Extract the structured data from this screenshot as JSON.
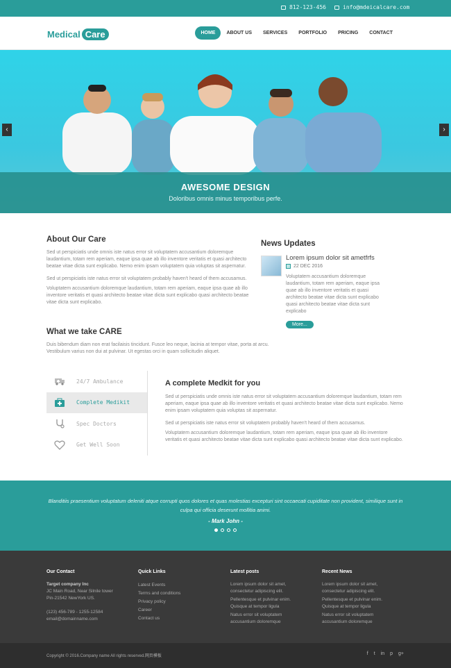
{
  "topbar": {
    "phone": "812-123-456",
    "email": "info@mdeicalcare.com"
  },
  "header": {
    "logo_text": "Medical",
    "logo_pill": "Care",
    "nav": [
      "HOME",
      "ABOUT US",
      "SERVICES",
      "PORTFOLIO",
      "PRICING",
      "CONTACT"
    ]
  },
  "hero": {
    "title": "AWESOME DESIGN",
    "subtitle": "Doloribus omnis minus temporibus perfe.",
    "prev": "‹",
    "next": "›"
  },
  "about": {
    "title": "About Our Care",
    "p1": "Sed ut perspiciatis unde omnis iste natus error sit voluptatem accusantium doloremque laudantium, totam rem aperiam, eaque ipsa quae ab illo inventore veritatis et quasi architecto beatae vitae dicta sunt explicabo. Nemo enim ipsam voluptatem quia voluptas sit aspernatur.",
    "p2": "Sed ut perspiciatis iste natus error sit voluptatem probably haven't heard of them accusamus.",
    "p3": "Voluptatem accusantium doloremque laudantium, totam rem aperiam, eaque ipsa quae ab illo inventore veritatis et quasi architecto beatae vitae dicta sunt explicabo quasi architecto beatae vitae dicta sunt explicabo."
  },
  "news": {
    "title": "News Updates",
    "item_title": "Lorem ipsum dolor sit ametfrfs",
    "date": "22 DEC 2016",
    "text": "Voluptatem accusantium doloremque laudantium, totam rem aperiam, eaque ipsa quae ab illo inventore veritatis et quasi architecto beatae vitae dicta sunt explicabo quasi architecto beatae vitae dicta sunt explicabo",
    "more": "More..."
  },
  "care": {
    "title": "What we take CARE",
    "text": "Duis bibendum diam non erat facilaisis tincidunt. Fusce leo neque, lacinia at tempor vitae, porta at arcu. Vestibulum varius non dui at pulvinar. Ut egestas orci in quam sollicitudin aliquet."
  },
  "tabs": [
    {
      "label": "24/7 Ambulance",
      "icon": "ambulance-icon"
    },
    {
      "label": "Complete Medikit",
      "icon": "medkit-icon"
    },
    {
      "label": "Spec Doctors",
      "icon": "stethoscope-icon"
    },
    {
      "label": "Get Well Soon",
      "icon": "heart-icon"
    }
  ],
  "medkit": {
    "title": "A complete Medkit for you",
    "p1": "Sed ut perspiciatis unde omnis iste natus error sit voluptatem accusantium doloremque laudantium, totam rem aperiam, eaque ipsa quae ab illo inventore veritatis et quasi architecto beatae vitae dicta sunt explicabo. Nemo enim ipsam voluptatem quia voluptas sit aspernatur.",
    "p2": "Sed ut perspiciatis iste natus error sit voluptatem probably haven't heard of them accusamus.",
    "p3": "Voluptatem accusantium doloremque laudantium, totam rem aperiam, eaque ipsa quae ab illo inventore veritatis et quasi architecto beatae vitae dicta sunt explicabo quasi architecto beatae vitae dicta sunt explicabo."
  },
  "testimonial": {
    "quote": "Blanditiis praesentium voluptatum deleniti atque corrupti quos dolores et quas molestias excepturi sint occaecati cupiditate non provident, similique sunt in culpa qui officia deserunt mollitia animi.",
    "author": "- Mark John -"
  },
  "footer": {
    "contact": {
      "title": "Our Contact",
      "company": "Target company Inc",
      "address1": "JC Main Road, Near Silnile tower",
      "address2": "Pin-21542 NewYork US.",
      "phone": "(123) 456-789 - 1255-12584",
      "email": "email@domainname.com"
    },
    "links": {
      "title": "Quick Links",
      "items": [
        "Latest Events",
        "Terms and conditions",
        "Privacy policy",
        "Career",
        "Contact us"
      ]
    },
    "posts": {
      "title": "Latest posts",
      "items": [
        "Lorem ipsum dolor sit amet,",
        "consectetur adipiscing elit.",
        "Pellentesque et pulvinar enim.",
        "Quisque at tempor ligula",
        "Natus error sit voluptatem",
        "accusantium doloremque"
      ]
    },
    "recent": {
      "title": "Recent News",
      "items": [
        "Lorem ipsum dolor sit amet,",
        "consectetur adipiscing elit.",
        "Pellentesque et pulvinar enim.",
        "Quisque at tempor ligula",
        "Natus error sit voluptatem",
        "accusantium doloremque"
      ]
    },
    "copyright": "Copyright © 2016.Company name All rights reserved.网页模板",
    "social": [
      "f",
      "t",
      "in",
      "p",
      "g+"
    ]
  },
  "colors": {
    "accent": "#2a9d9a",
    "footer": "#3a3a3a"
  }
}
